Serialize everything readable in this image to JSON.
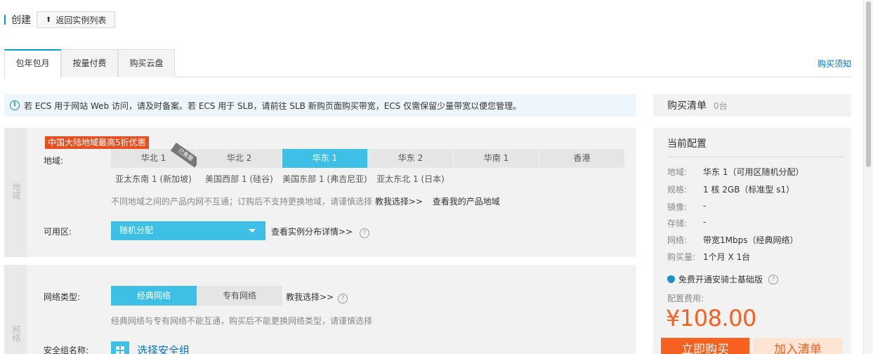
{
  "header": {
    "title": "创建",
    "back_label": "返回实例列表"
  },
  "tabs": [
    {
      "label": "包年包月",
      "active": true
    },
    {
      "label": "按量付费",
      "active": false
    },
    {
      "label": "购买云盘",
      "active": false
    }
  ],
  "buy_note": "购买须知",
  "notice": "若 ECS 用于网站 Web 访问，请及时备案。若 ECS 用于 SLB，请前往 SLB 新购页面购买带宽，ECS 仅需保留少量带宽以便您管理。",
  "region_section": {
    "side_label": "地域",
    "promo": "中国大陆地域最高5折优惠",
    "region_label": "地域:",
    "regions_row1": [
      "华北 1",
      "华北 2",
      "华东 1",
      "华东 2",
      "华南 1",
      "香港"
    ],
    "regions_row2": [
      "亚太东南 1 (新加坡)",
      "美国西部 1 (硅谷)",
      "美国东部 1 (弗吉尼亚)",
      "亚太东北 1 (日本)"
    ],
    "selected_region": "华东 1",
    "sold_out_tag": "已售罄",
    "region_hint": "不同地域之间的产品内网不互通；订购后不支持更换地域，请谨慎选择",
    "help_link": "教我选择>>",
    "my_regions_link": "查看我的产品地域",
    "zone_label": "可用区:",
    "zone_value": "随机分配",
    "zone_detail_link": "查看实例分布详情>>"
  },
  "network_section": {
    "side_label": "网络",
    "type_label": "网络类型:",
    "options": [
      "经典网络",
      "专有网络"
    ],
    "selected": "经典网络",
    "help_link": "教我选择>>",
    "hint": "经典网络与专有网络不能互通，购买后不能更换网络类型，请谨慎选择",
    "sg_label": "安全组名称:",
    "sg_button": "选择安全组"
  },
  "cart": {
    "title": "购买清单",
    "count": "0台",
    "config_title": "当前配置",
    "specs": [
      {
        "k": "地域:",
        "v": "华东 1（可用区随机分配）"
      },
      {
        "k": "规格:",
        "v": "1 核 2GB（标准型 s1）"
      },
      {
        "k": "镜像:",
        "v": "-"
      },
      {
        "k": "存储:",
        "v": "-"
      },
      {
        "k": "网络:",
        "v": "带宽1Mbps（经典网络）"
      },
      {
        "k": "购买量:",
        "v": "1个月 X 1台"
      }
    ],
    "aegis": "免费开通安骑士基础版",
    "fee_label": "配置费用:",
    "price": "¥108.00",
    "buy_label": "立即购买",
    "add_label": "加入清单"
  },
  "colors": {
    "accent": "#3ec0e6",
    "price": "#f7601e",
    "link": "#0070cc",
    "promo": "#e84e1f"
  }
}
